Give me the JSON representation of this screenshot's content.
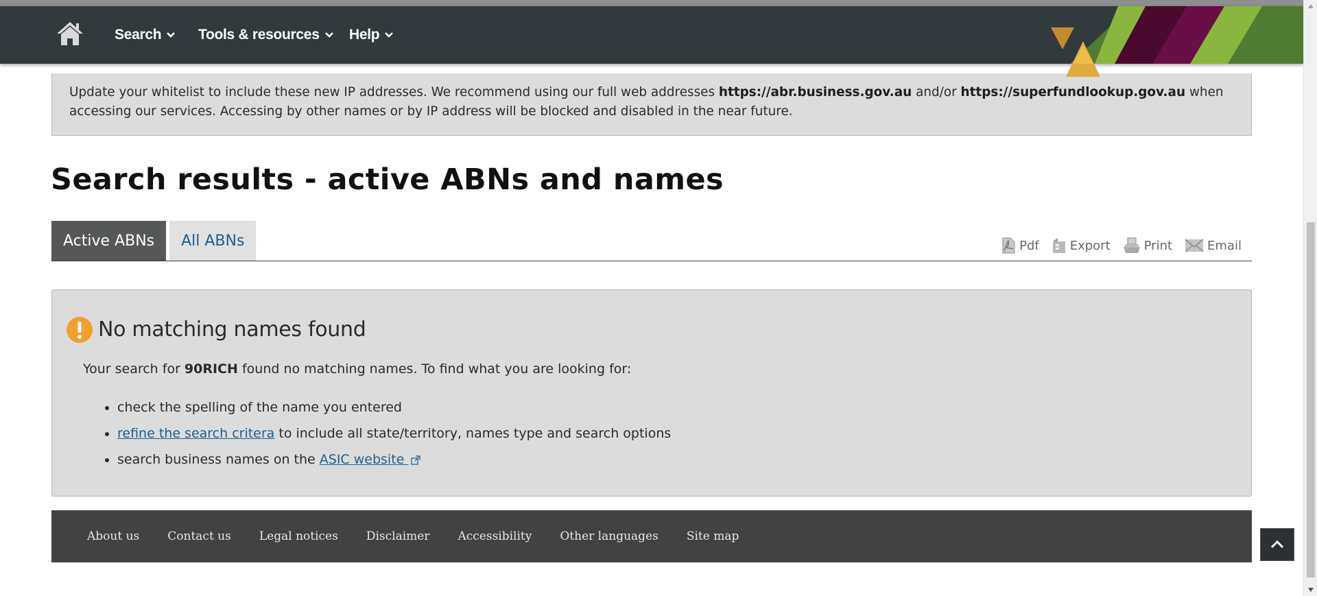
{
  "header": {
    "nav": [
      {
        "label": "Search"
      },
      {
        "label": "Tools & resources"
      },
      {
        "label": "Help"
      }
    ]
  },
  "notice": {
    "text_1": "Update your whitelist to include these new IP addresses. We recommend using our full web addresses ",
    "domain_1": "https://abr.business.gov.au",
    "text_2": " and/or ",
    "domain_2": "https://superfundlookup.gov.au",
    "text_3": " when accessing our services. Accessing by other names or by IP address will be blocked and disabled in the near future."
  },
  "page_title": "Search results - active ABNs and names",
  "tabs": [
    {
      "label": "Active ABNs",
      "active": true
    },
    {
      "label": "All ABNs",
      "active": false
    }
  ],
  "actions": {
    "pdf": "Pdf",
    "export": "Export",
    "print": "Print",
    "email": "Email"
  },
  "results": {
    "heading": "No matching names found",
    "msg_prefix": "Your search for ",
    "search_term": "90RICH",
    "msg_suffix": " found no matching names. To find what you are looking for:",
    "suggestions": {
      "item1": "check the spelling of the name you entered",
      "item2_link": "refine the search critera",
      "item2_rest": " to include all state/territory, names type and search options",
      "item3_prefix": "search business names on the ",
      "item3_link": "ASIC website "
    }
  },
  "footer": {
    "links": [
      "About us",
      "Contact us",
      "Legal notices",
      "Disclaimer",
      "Accessibility",
      "Other languages",
      "Site map"
    ]
  },
  "icons": {
    "home": "home-icon",
    "chevron": "chevron-down-icon",
    "warning": "exclamation-circle-icon",
    "pdf": "pdf-icon",
    "export": "export-icon",
    "print": "print-icon",
    "email": "envelope-icon",
    "external": "external-link-icon",
    "back_to_top": "chevron-up-icon"
  },
  "colors": {
    "header_bg": "#333a3e",
    "accent_green": "#8ab53f",
    "accent_purple": "#6a0f45",
    "accent_gold": "#d9a53c",
    "warning_orange": "#f0a030",
    "link_blue": "#1b5f92",
    "tab_active_bg": "#555759",
    "footer_bg": "#424242"
  }
}
